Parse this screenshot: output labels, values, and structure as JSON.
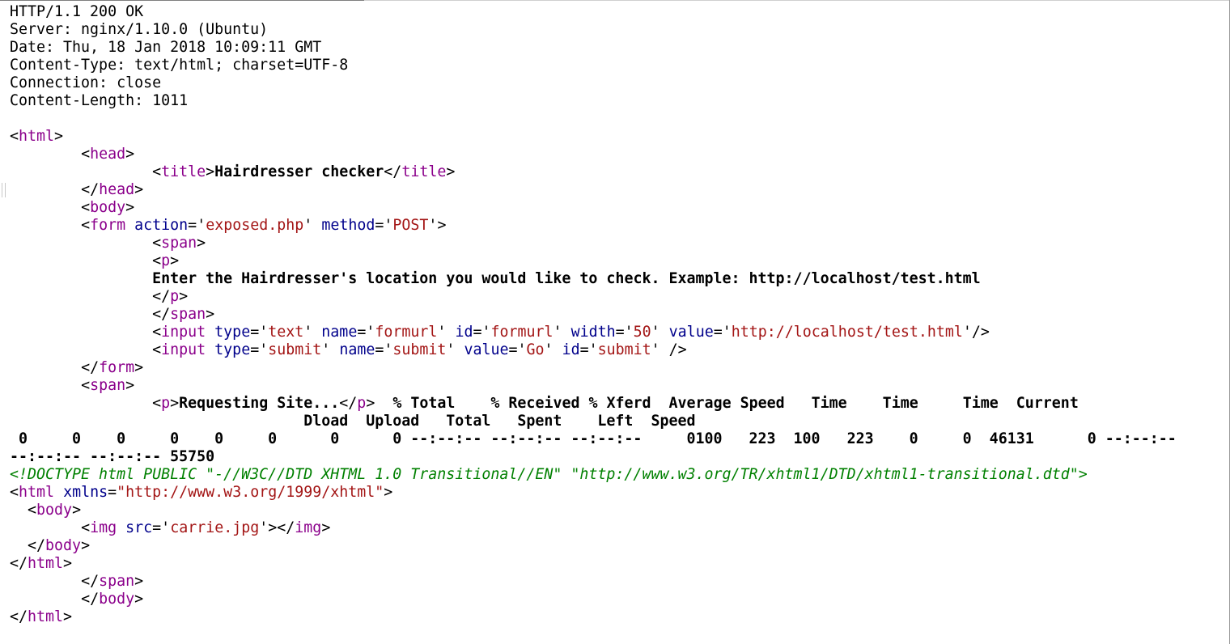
{
  "headers": [
    "HTTP/1.1 200 OK",
    "Server: nginx/1.10.0 (Ubuntu)",
    "Date: Thu, 18 Jan 2018 10:09:11 GMT",
    "Content-Type: text/html; charset=UTF-8",
    "Connection: close",
    "Content-Length: 1011"
  ],
  "tags": {
    "html": "html",
    "head": "head",
    "title": "title",
    "body": "body",
    "form": "form",
    "span": "span",
    "p": "p",
    "input": "input",
    "img": "img"
  },
  "attrs": {
    "action": "action",
    "method": "method",
    "type": "type",
    "name": "name",
    "id": "id",
    "width": "width",
    "value": "value",
    "xmlns": "xmlns",
    "src": "src"
  },
  "content": {
    "title_text": "Hairdresser checker",
    "form_action": "exposed.php",
    "form_method": "POST",
    "prompt_text": "Enter the Hairdresser's location you would like to check. Example: http://localhost/test.html",
    "input1_type": "text",
    "input1_name": "formurl",
    "input1_id": "formurl",
    "input1_width": "50",
    "input1_value": "http://localhost/test.html",
    "input2_type": "submit",
    "input2_name": "submit",
    "input2_value": "Go",
    "input2_id": "submit",
    "requesting_text": "Requesting Site...",
    "curl_header_1": "  % Total    % Received % Xferd  Average Speed   Time    Time     Time  Current",
    "curl_header_2": "                                 Dload  Upload   Total   Spent    Left  Speed",
    "curl_row_1": " 0     0    0     0    0     0      0      0 --:--:-- --:--:-- --:--:--     0100   223  100   223    0     0  46131      0 --:--:--",
    "curl_row_2": "--:--:-- --:--:-- 55750",
    "doctype": "<!DOCTYPE html PUBLIC \"-//W3C//DTD XHTML 1.0 Transitional//EN\" \"http://www.w3.org/TR/xhtml1/DTD/xhtml1-transitional.dtd\">",
    "xmlns_value": "\"http://www.w3.org/1999/xhtml\"",
    "img_src": "carrie.jpg"
  },
  "punct": {
    "lt": "<",
    "gt": ">",
    "close_lt": "</",
    "self_close": "/>",
    "self_close_sp": " />",
    "eq": "=",
    "q": "'"
  }
}
